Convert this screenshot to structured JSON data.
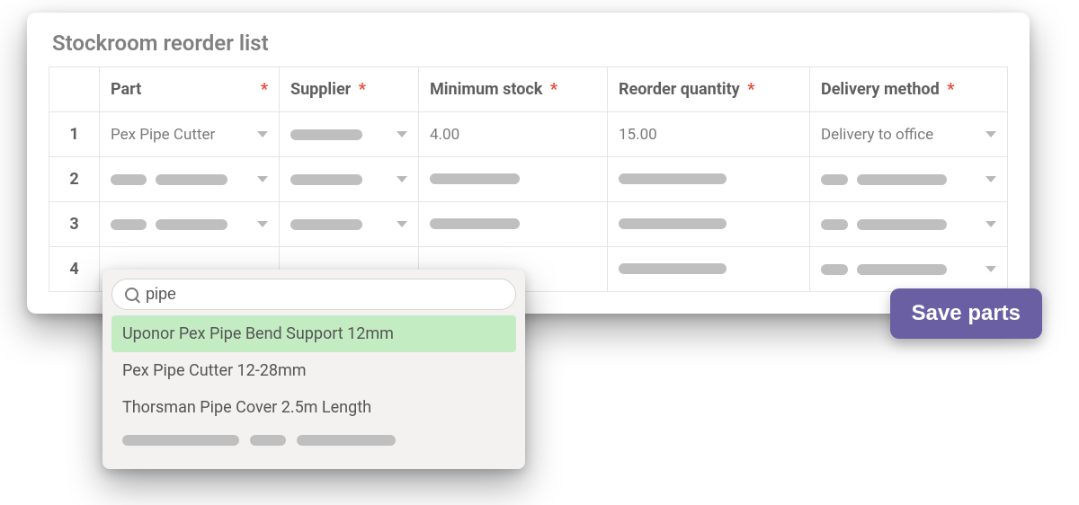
{
  "title": "Stockroom reorder list",
  "required_mark": "*",
  "columns": {
    "part": "Part",
    "supplier": "Supplier",
    "min_stock": "Minimum stock",
    "reorder_qty": "Reorder quantity",
    "delivery": "Delivery method"
  },
  "rows": [
    {
      "num": "1",
      "part": "Pex Pipe Cutter",
      "supplier": "",
      "min_stock": "4.00",
      "reorder_qty": "15.00",
      "delivery": "Delivery to office"
    },
    {
      "num": "2"
    },
    {
      "num": "3"
    },
    {
      "num": "4"
    }
  ],
  "save_button": "Save parts",
  "dropdown": {
    "search_value": "pipe",
    "options": [
      "Uponor Pex Pipe Bend Support 12mm",
      "Pex Pipe Cutter 12-28mm",
      "Thorsman Pipe Cover 2.5m Length"
    ],
    "highlighted_index": 0
  }
}
